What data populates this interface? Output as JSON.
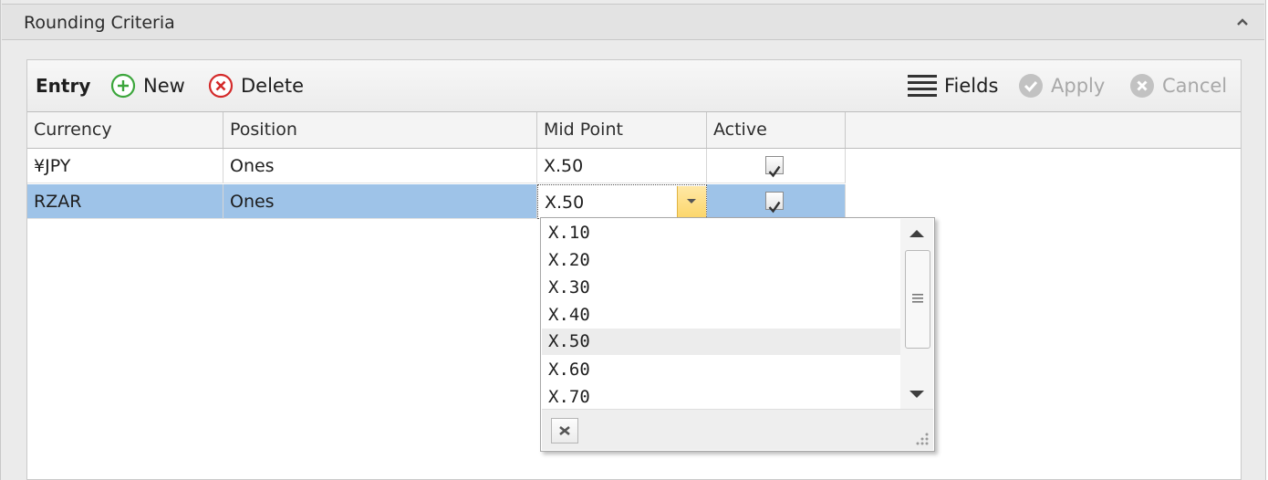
{
  "group": {
    "title": "Rounding Criteria"
  },
  "toolbar": {
    "entry_label": "Entry",
    "new_label": "New",
    "delete_label": "Delete",
    "fields_label": "Fields",
    "apply_label": "Apply",
    "cancel_label": "Cancel"
  },
  "grid": {
    "columns": [
      "Currency",
      "Position",
      "Mid Point",
      "Active"
    ],
    "rows": [
      {
        "currency": "¥JPY",
        "position": "Ones",
        "mid_point": "X.50",
        "active": true
      },
      {
        "currency": "RZAR",
        "position": "Ones",
        "mid_point": "X.50",
        "active": true
      }
    ]
  },
  "dropdown": {
    "options": [
      "X.10",
      "X.20",
      "X.30",
      "X.40",
      "X.50",
      "X.60",
      "X.70"
    ],
    "highlighted": "X.50"
  },
  "colors": {
    "selection": "#9ec3e8",
    "new_icon": "#3ca63c",
    "delete_icon": "#d42a2a",
    "dropdown_button": "#fcd66a"
  }
}
